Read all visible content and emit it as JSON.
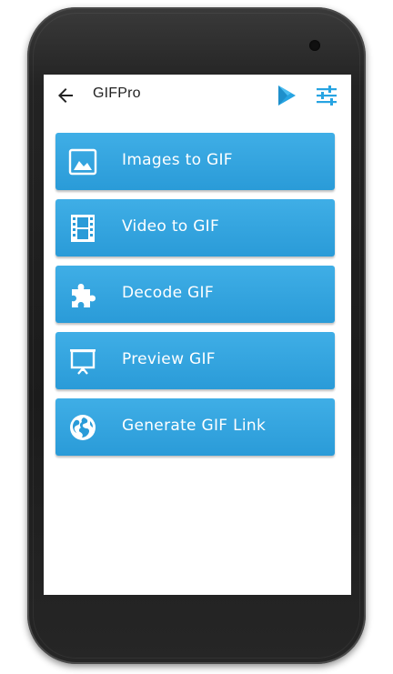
{
  "toolbar": {
    "title": "GIFPro",
    "back_icon": "back-arrow-icon",
    "play_icon": "play-store-icon",
    "settings_icon": "sliders-icon"
  },
  "menu": [
    {
      "label": "Images to GIF",
      "icon": "image-icon"
    },
    {
      "label": "Video to GIF",
      "icon": "film-icon"
    },
    {
      "label": "Decode GIF",
      "icon": "puzzle-icon"
    },
    {
      "label": "Preview GIF",
      "icon": "presentation-icon"
    },
    {
      "label": "Generate GIF Link",
      "icon": "globe-icon"
    }
  ],
  "colors": {
    "button": "#2a9bd8",
    "accent": "#27a4e2",
    "text_on_button": "#ffffff"
  }
}
